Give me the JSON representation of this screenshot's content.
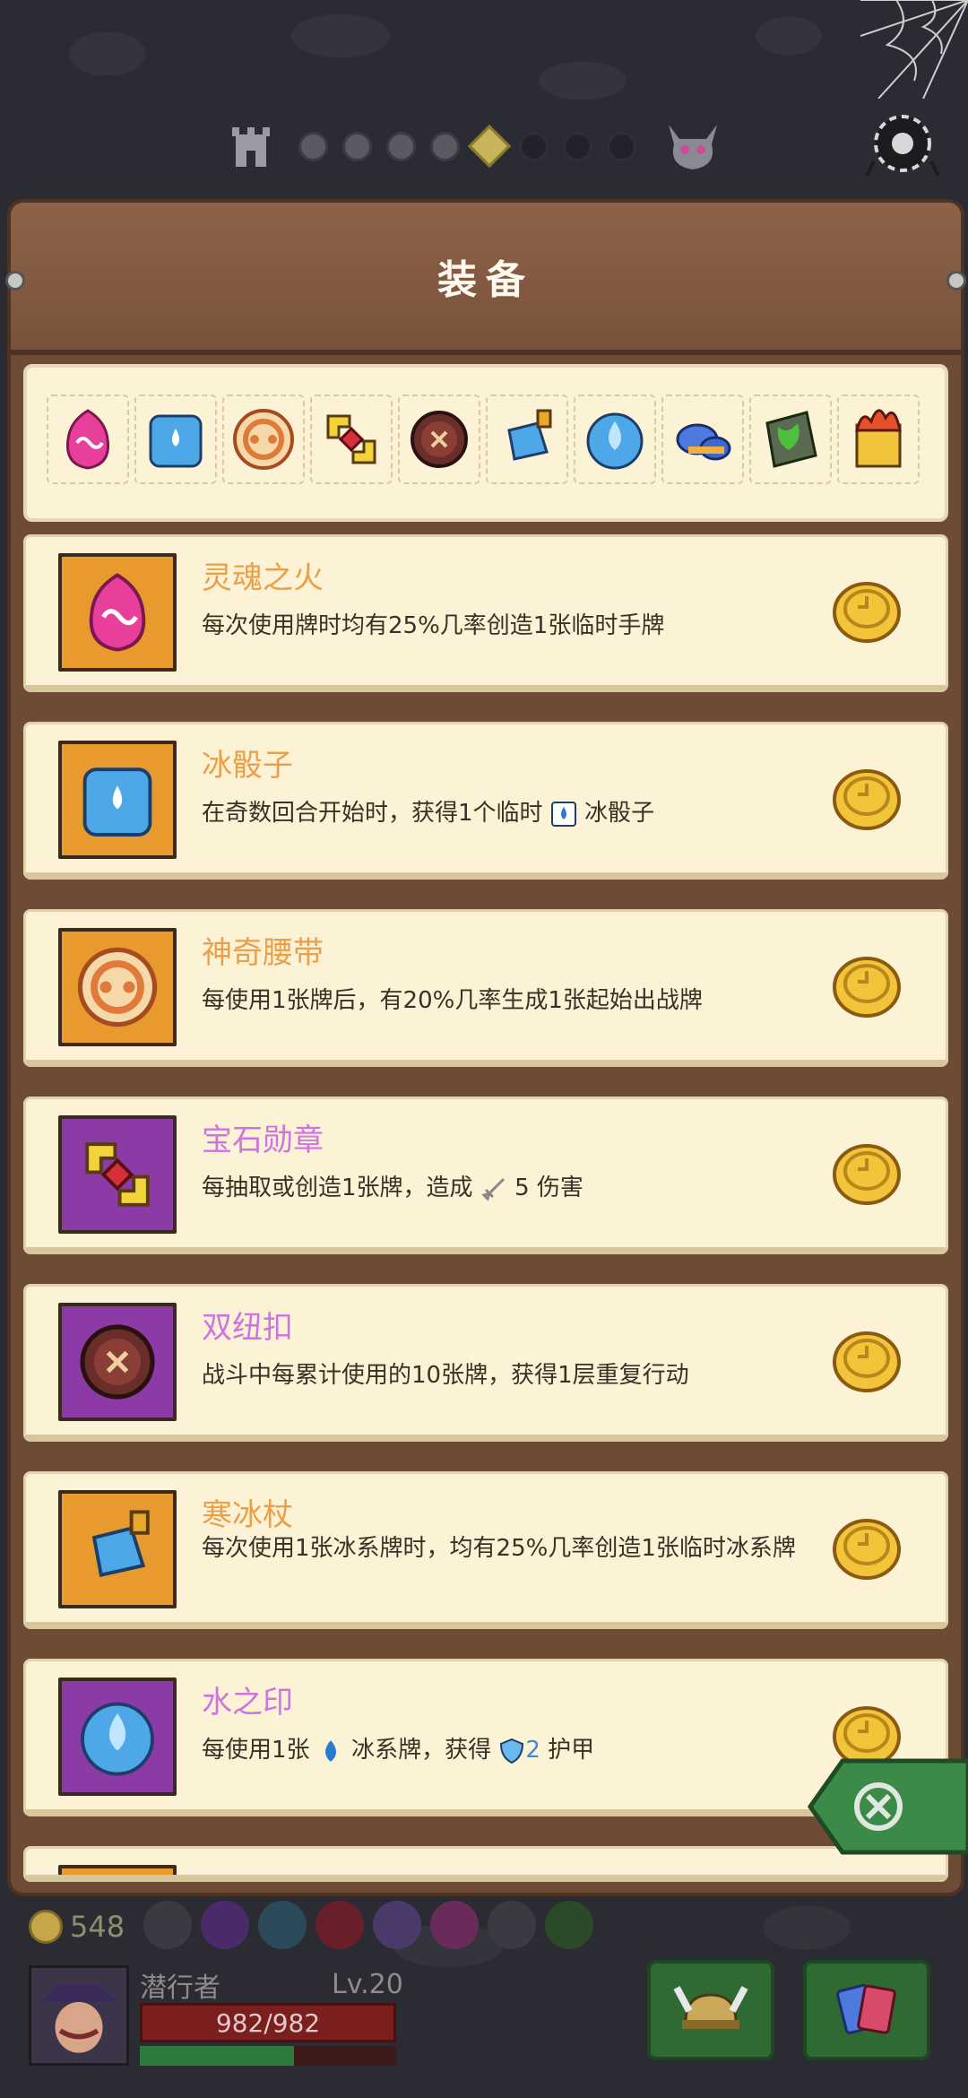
{
  "panel": {
    "title": "装备"
  },
  "progress": {
    "dots": [
      "light",
      "light",
      "light",
      "light",
      "current",
      "dark",
      "dark",
      "dark"
    ]
  },
  "strip": {
    "icons": [
      "soul-fire-icon",
      "ice-dice-icon",
      "magic-belt-icon",
      "gem-medal-icon",
      "double-button-icon",
      "frost-staff-icon",
      "water-seal-icon",
      "mushroom-icon",
      "moss-stone-icon",
      "flame-cube-icon"
    ]
  },
  "items": [
    {
      "name": "灵魂之火",
      "color": "orange",
      "icon": "soul-fire-icon",
      "desc": "每次使用牌时均有25%几率创造1张临时手牌"
    },
    {
      "name": "冰骰子",
      "color": "orange",
      "icon": "ice-dice-icon",
      "desc_a": "在奇数回合开始时，获得1个临时",
      "desc_b": "冰骰子"
    },
    {
      "name": "神奇腰带",
      "color": "orange",
      "icon": "magic-belt-icon",
      "desc": "每使用1张牌后，有20%几率生成1张起始出战牌"
    },
    {
      "name": "宝石勋章",
      "color": "purple",
      "icon": "gem-medal-icon",
      "desc_a": "每抽取或创造1张牌，造成",
      "desc_b": "5 伤害"
    },
    {
      "name": "双纽扣",
      "color": "purple",
      "icon": "double-button-icon",
      "desc": "战斗中每累计使用的10张牌，获得1层重复行动"
    },
    {
      "name": "寒冰杖",
      "color": "orange",
      "icon": "frost-staff-icon",
      "desc": "每次使用1张冰系牌时，均有25%几率创造1张临时冰系牌"
    },
    {
      "name": "水之印",
      "color": "purple",
      "icon": "water-seal-icon",
      "desc_a": "每使用1张",
      "desc_b": "冰系牌，获得",
      "desc_c": "2",
      "desc_d": " 护甲"
    }
  ],
  "hud": {
    "gold": "548",
    "player_name": "潜行者",
    "level": "Lv.20",
    "hp": "982/982",
    "xp_fraction": 0.6
  },
  "colors": {
    "orange": "#e99a2e",
    "purple": "#8c3aa6",
    "panel": "#6e4b35",
    "card": "#fcf3d7"
  }
}
